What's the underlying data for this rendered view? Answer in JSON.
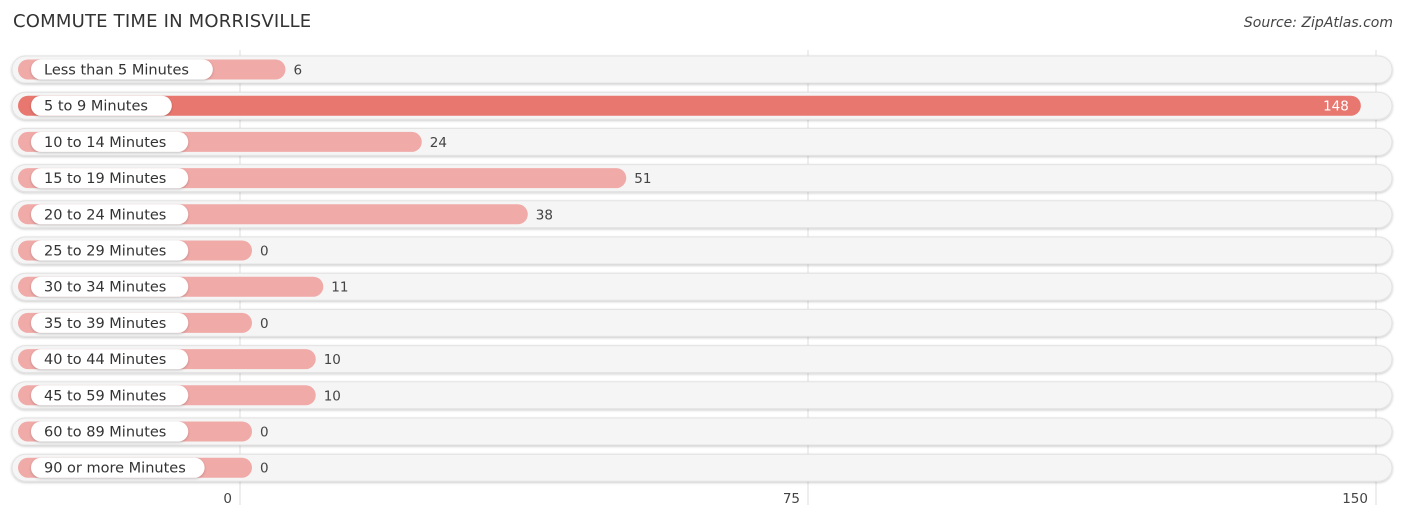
{
  "chart_data": {
    "type": "bar",
    "orientation": "horizontal",
    "title": "COMMUTE TIME IN MORRISVILLE",
    "source": "Source: ZipAtlas.com",
    "categories": [
      "Less than 5 Minutes",
      "5 to 9 Minutes",
      "10 to 14 Minutes",
      "15 to 19 Minutes",
      "20 to 24 Minutes",
      "25 to 29 Minutes",
      "30 to 34 Minutes",
      "35 to 39 Minutes",
      "40 to 44 Minutes",
      "45 to 59 Minutes",
      "60 to 89 Minutes",
      "90 or more Minutes"
    ],
    "values": [
      6,
      148,
      24,
      51,
      38,
      0,
      11,
      0,
      10,
      10,
      0,
      0
    ],
    "xlim": [
      0,
      150
    ],
    "xticks": [
      "0",
      "75",
      "150"
    ],
    "xtick_values": [
      0,
      75,
      150
    ],
    "grid": true,
    "colors": {
      "bar": "#f0aaa8",
      "bar_highlight": "#e8776f",
      "track": "#f5f5f5"
    }
  }
}
